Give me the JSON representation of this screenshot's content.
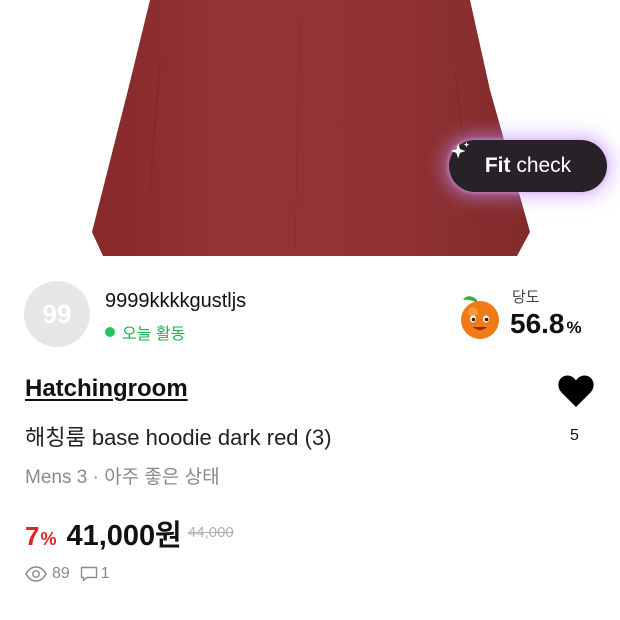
{
  "product_image": {
    "alt": "dark red hoodie"
  },
  "fit_check": {
    "label_bold": "Fit",
    "label_rest": "check",
    "icon": "sparkle-icon"
  },
  "seller": {
    "avatar_text": "99",
    "username": "9999kkkkgustljs",
    "activity": "오늘 활동",
    "activity_color": "#22c55e"
  },
  "sweetness": {
    "label": "당도",
    "value": "56.8",
    "unit": "%",
    "icon": "peach-face-icon"
  },
  "product": {
    "shop": "Hatchingroom",
    "title": "해칭룸 base hoodie dark red (3)",
    "meta": "Mens 3 · 아주 좋은 상태",
    "discount": "7",
    "discount_unit": "%",
    "price": "41,000원",
    "original_price": "44,000"
  },
  "likes": {
    "count": "5",
    "icon": "heart-icon"
  },
  "stats": {
    "views": "89",
    "chats": "1"
  },
  "colors": {
    "hoodie": "#8e3132",
    "discount": "#e02424",
    "fit_button_bg": "#262228"
  }
}
